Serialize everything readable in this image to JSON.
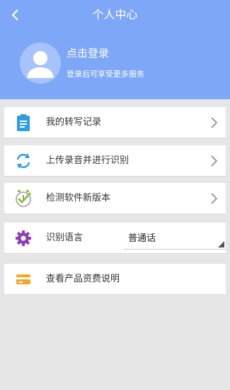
{
  "header": {
    "title": "个人中心",
    "back_icon": "chevron-left-icon",
    "background": "#7ea7f7"
  },
  "profile": {
    "login_title": "点击登录",
    "login_subtitle": "登录后可享受更多服务",
    "avatar_icon": "user-avatar-icon"
  },
  "menu": {
    "records": {
      "label": "我的转写记录",
      "icon": "clipboard-icon",
      "icon_color": "#2f9ce8"
    },
    "upload": {
      "label": "上传录音并进行识别",
      "icon": "refresh-icon",
      "icon_color": "#2f9ce8"
    },
    "update": {
      "label": "检测软件新版本",
      "icon": "clock-check-icon",
      "icon_color": "#8bc34a"
    },
    "language": {
      "label": "识别语言",
      "icon": "gear-icon",
      "icon_color": "#8e3db8",
      "selected": "普通话"
    },
    "pricing": {
      "label": "查看产品资费说明",
      "icon": "card-icon",
      "icon_color": "#f5a623"
    }
  }
}
